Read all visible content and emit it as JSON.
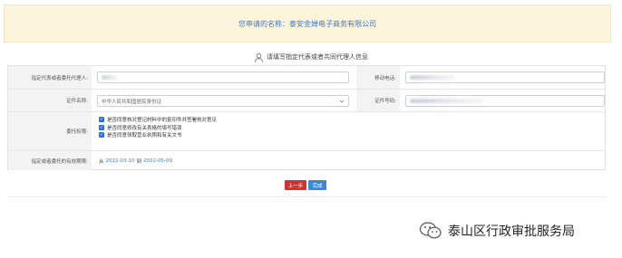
{
  "banner": {
    "prefix": "您申请的名称：",
    "company": "泰安金婵电子商务有限公司"
  },
  "section": {
    "title": "请填写指定代表或者共同代理人信息",
    "icon": "person-icon"
  },
  "form": {
    "agent_label": "指定代表或者委托代理人:",
    "mobile_label": "移动电话:",
    "id_type_label": "证件名称:",
    "id_type_value": "中华人民共和国居民身份证",
    "id_number_label": "证件号码:",
    "authority_label": "委托权限:",
    "authority_items": [
      "是否同意核对登记材料中的复印件并签署核对意见",
      "是否同意修改有关表格的填写错误",
      "是否同意领取营业执照和有关文书"
    ],
    "validity_label": "指定或者委托的有效期限:",
    "validity_from": "从",
    "validity_start": "2022-03-10",
    "validity_to": "到",
    "validity_end": "2022-05-09"
  },
  "buttons": {
    "prev": "上一步",
    "done": "完成"
  },
  "watermark": {
    "text": "泰山区行政审批服务局",
    "icon": "wechat-public-account-icon"
  },
  "colors": {
    "banner_bg": "#fdf4dc",
    "accent": "#3f7ac0",
    "prev_button": "#d33030",
    "done_button": "#3d86d2",
    "checkbox": "#2f6fd6"
  }
}
